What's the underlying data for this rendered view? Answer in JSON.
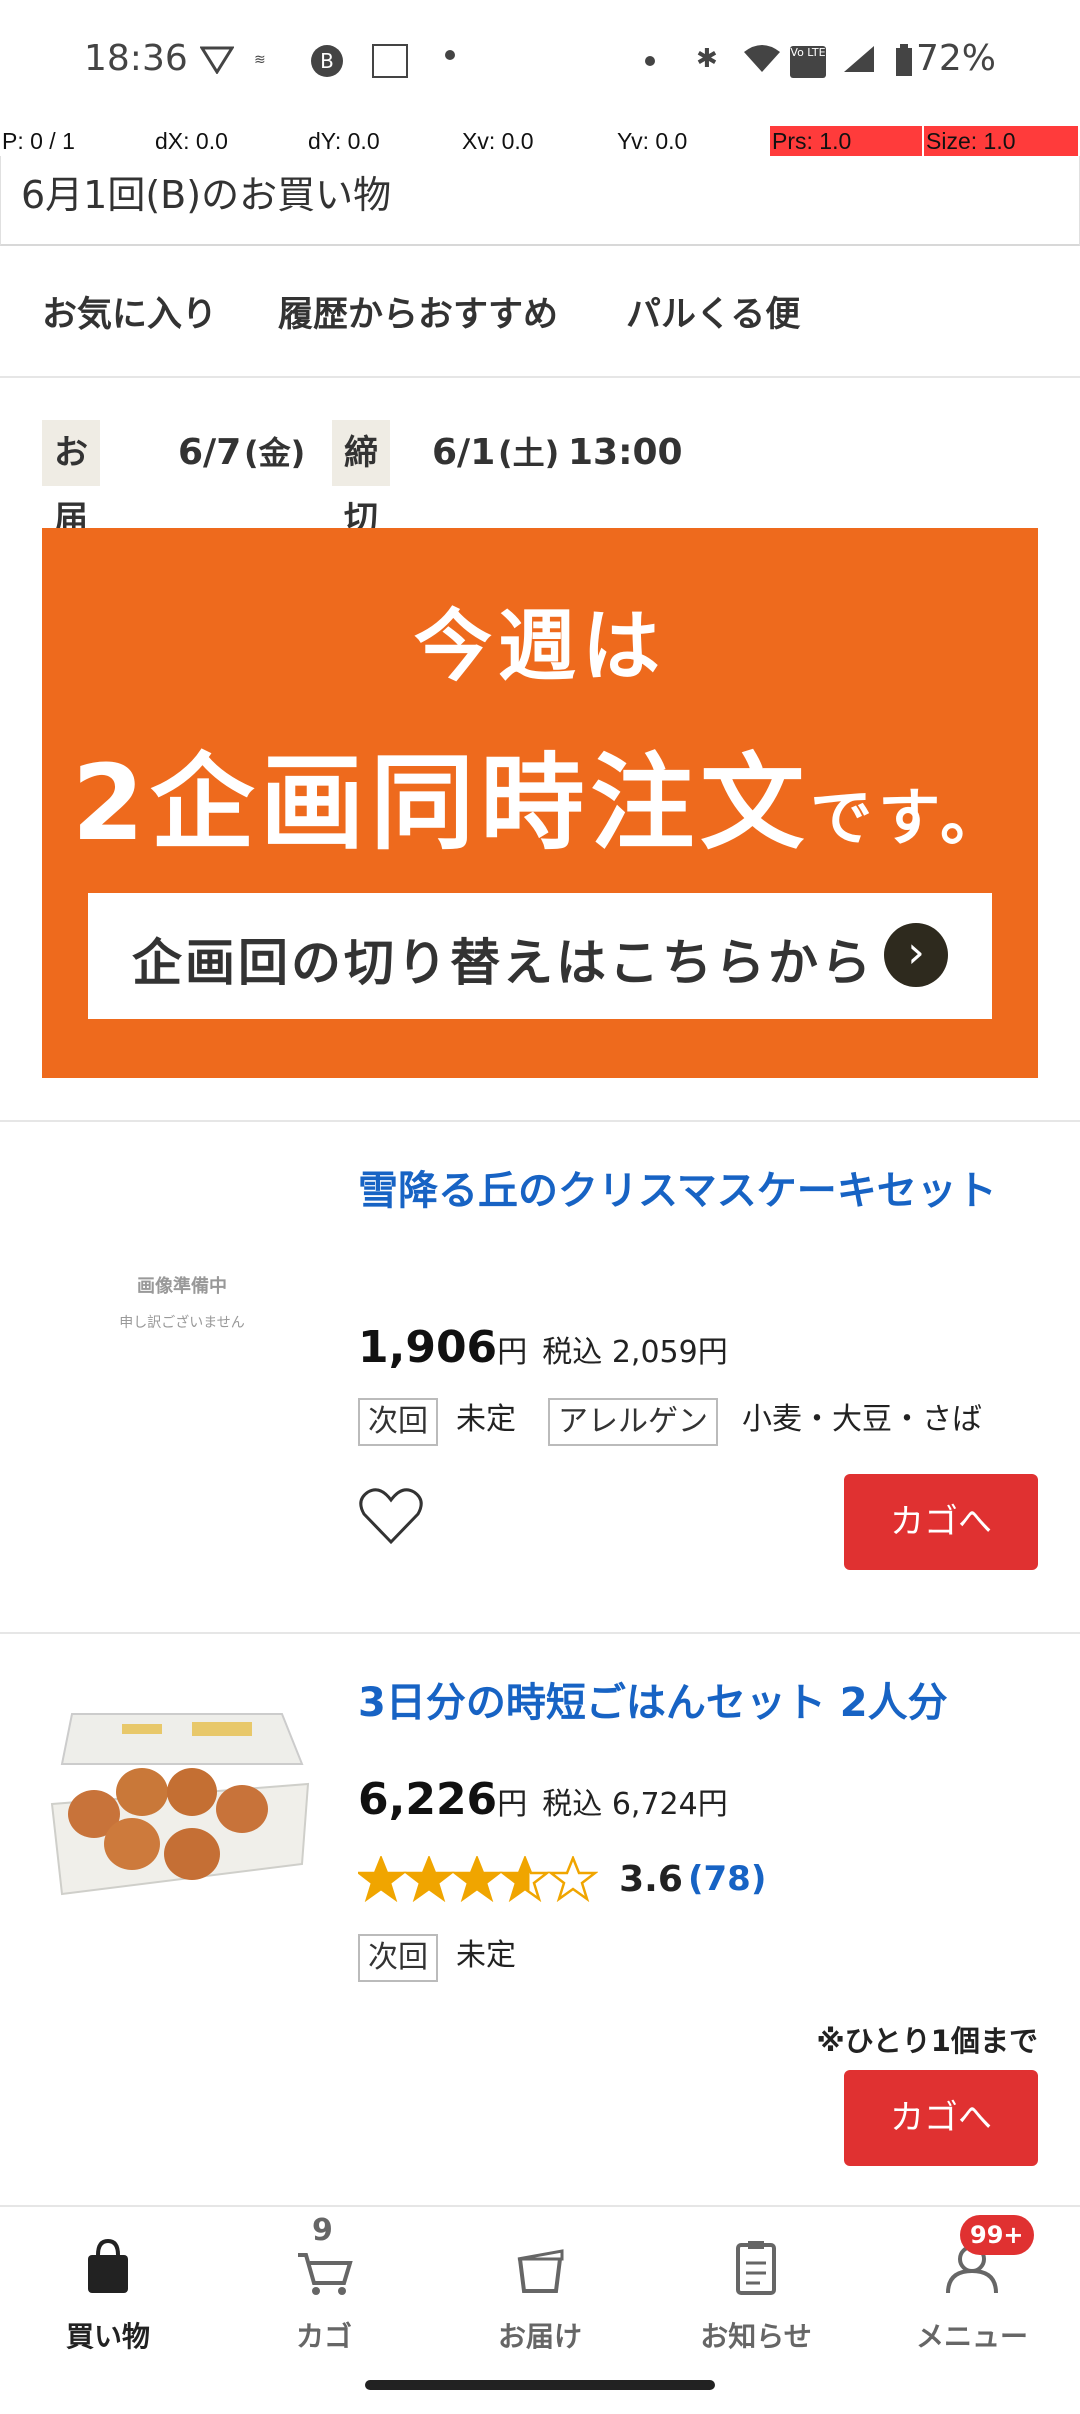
{
  "status": {
    "time": "18:36",
    "battery": "72%",
    "lte": "Vo LTE"
  },
  "debug": {
    "p": "P: 0 / 1",
    "dx": "dX: 0.0",
    "dy": "dY: 0.0",
    "xv": "Xv: 0.0",
    "yv": "Yv: 0.0",
    "prs": "Prs: 1.0",
    "size": "Size: 1.0"
  },
  "header": {
    "title": "6月1回(B)のお買い物"
  },
  "tabs": [
    {
      "label": "お気に入り"
    },
    {
      "label": "履歴からおすすめ"
    },
    {
      "label": "パルくる便"
    }
  ],
  "delivery": {
    "deliver_label": "お届け",
    "deliver_date": "6/7",
    "deliver_dow": "(金)",
    "deadline_label": "締切",
    "deadline_date": "6/1",
    "deadline_dow": "(土)",
    "deadline_time": "13:00"
  },
  "banner": {
    "line1": "今週は",
    "line2_big": "2企画同時注文",
    "line2_small": "です。",
    "button": "企画回の切り替えはこちらから"
  },
  "products": [
    {
      "name": "雪降る丘のクリスマスケーキセット",
      "image_text_1": "画像準備中",
      "image_text_2": "申し訳ございません",
      "price": "1,906",
      "unit": "円",
      "tax_price": "税込 2,059円",
      "next_label": "次回",
      "next_value": "未定",
      "allergen_label": "アレルゲン",
      "allergen_value": "小麦・大豆・さば",
      "cart_label": "カゴへ"
    },
    {
      "name": "3日分の時短ごはんセット 2人分",
      "price": "6,226",
      "unit": "円",
      "tax_price": "税込 6,724円",
      "rating": 3.6,
      "rating_text": "3.6",
      "review_count": "(78)",
      "next_label": "次回",
      "next_value": "未定",
      "limit_note": "※ひとり1個まで",
      "cart_label": "カゴへ"
    }
  ],
  "nav": {
    "items": [
      {
        "label": "買い物"
      },
      {
        "label": "カゴ"
      },
      {
        "label": "お届け"
      },
      {
        "label": "お知らせ"
      },
      {
        "label": "メニュー"
      }
    ],
    "cart_count": "9",
    "menu_badge": "99+"
  },
  "colors": {
    "accent_red": "#e03131",
    "banner_orange": "#ee6a1d",
    "link_blue": "#1763c4",
    "star": "#f0a500"
  }
}
